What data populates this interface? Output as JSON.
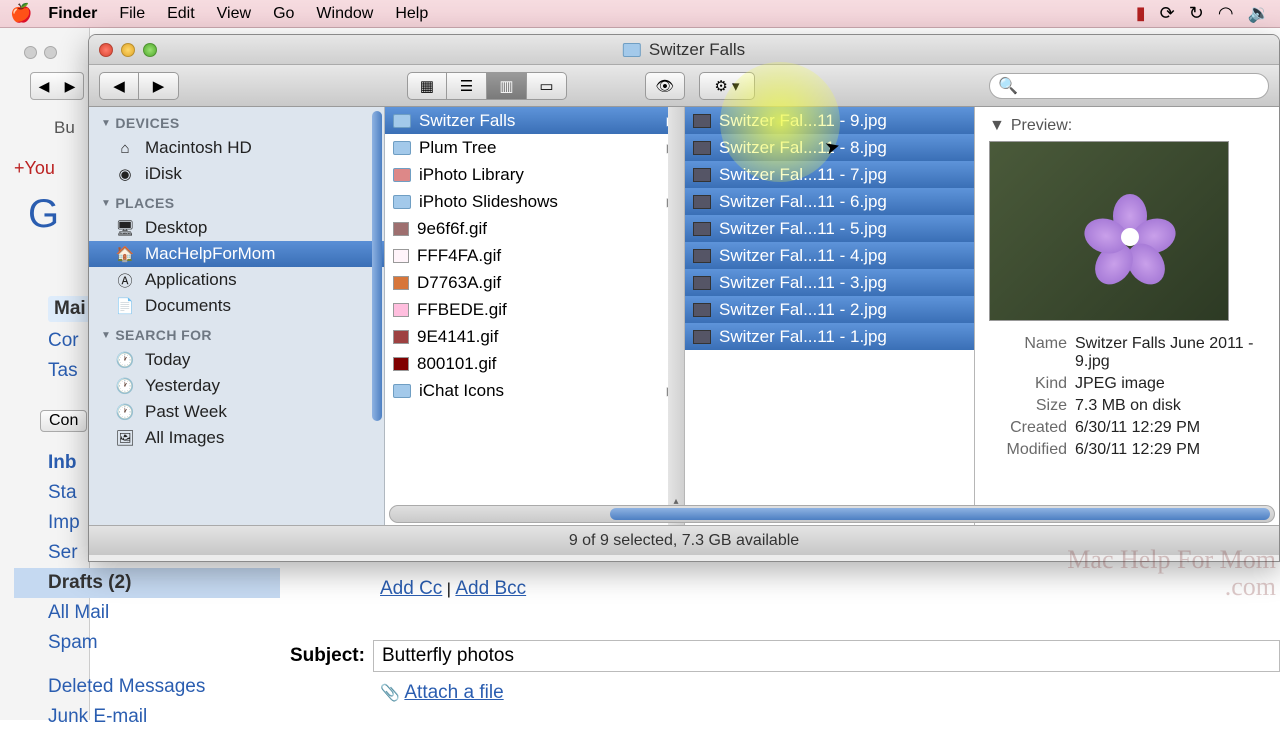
{
  "menubar": {
    "app": "Finder",
    "items": [
      "File",
      "Edit",
      "View",
      "Go",
      "Window",
      "Help"
    ]
  },
  "finder": {
    "title": "Switzer Falls",
    "sidebar": {
      "sections": [
        {
          "label": "DEVICES",
          "items": [
            {
              "name": "Macintosh HD",
              "icon": "hdd"
            },
            {
              "name": "iDisk",
              "icon": "idisk"
            }
          ]
        },
        {
          "label": "PLACES",
          "items": [
            {
              "name": "Desktop",
              "icon": "desktop"
            },
            {
              "name": "MacHelpForMom",
              "icon": "home",
              "selected": true
            },
            {
              "name": "Applications",
              "icon": "apps"
            },
            {
              "name": "Documents",
              "icon": "doc"
            }
          ]
        },
        {
          "label": "SEARCH FOR",
          "items": [
            {
              "name": "Today",
              "icon": "clock"
            },
            {
              "name": "Yesterday",
              "icon": "clock"
            },
            {
              "name": "Past Week",
              "icon": "clock"
            },
            {
              "name": "All Images",
              "icon": "img"
            }
          ]
        }
      ]
    },
    "column1": [
      {
        "name": "Switzer Falls",
        "type": "folder",
        "selected": true,
        "arrow": true
      },
      {
        "name": "Plum Tree",
        "type": "folder",
        "arrow": true
      },
      {
        "name": "iPhoto Library",
        "type": "app"
      },
      {
        "name": "iPhoto Slideshows",
        "type": "folder",
        "arrow": true
      },
      {
        "name": "9e6f6f.gif",
        "type": "gif",
        "color": "#9e6f6f"
      },
      {
        "name": "FFF4FA.gif",
        "type": "gif",
        "color": "#fff4fa"
      },
      {
        "name": "D7763A.gif",
        "type": "gif",
        "color": "#d7763a"
      },
      {
        "name": "FFBEDE.gif",
        "type": "gif",
        "color": "#ffbede"
      },
      {
        "name": "9E4141.gif",
        "type": "gif",
        "color": "#9e4141"
      },
      {
        "name": "800101.gif",
        "type": "gif",
        "color": "#800101"
      },
      {
        "name": "iChat Icons",
        "type": "folder",
        "arrow": true
      }
    ],
    "column2": [
      {
        "name": "Switzer Fal...11 - 9.jpg"
      },
      {
        "name": "Switzer Fal...11 - 8.jpg"
      },
      {
        "name": "Switzer Fal...11 - 7.jpg"
      },
      {
        "name": "Switzer Fal...11 - 6.jpg"
      },
      {
        "name": "Switzer Fal...11 - 5.jpg"
      },
      {
        "name": "Switzer Fal...11 - 4.jpg"
      },
      {
        "name": "Switzer Fal...11 - 3.jpg"
      },
      {
        "name": "Switzer Fal...11 - 2.jpg"
      },
      {
        "name": "Switzer Fal...11 - 1.jpg"
      }
    ],
    "preview": {
      "header": "Preview:",
      "meta": {
        "name_label": "Name",
        "name": "Switzer Falls June 2011 - 9.jpg",
        "kind_label": "Kind",
        "kind": "JPEG image",
        "size_label": "Size",
        "size": "7.3 MB on disk",
        "created_label": "Created",
        "created": "6/30/11 12:29 PM",
        "modified_label": "Modified",
        "modified": "6/30/11 12:29 PM"
      }
    },
    "status": "9 of 9 selected, 7.3 GB available"
  },
  "bg": {
    "plusyou": "+You",
    "tab": "Bu",
    "labels": [
      "Mai",
      "Cor",
      "Tas"
    ],
    "compose_btn": "Con"
  },
  "gmail": {
    "folders": [
      {
        "label": "Inb",
        "bold": true
      },
      {
        "label": "Sta"
      },
      {
        "label": "Imp"
      },
      {
        "label": "Ser"
      },
      {
        "label": "Drafts  (2)",
        "selected": true
      },
      {
        "label": "All Mail"
      },
      {
        "label": "Spam"
      },
      {
        "label": "",
        "sep": true
      },
      {
        "label": "Deleted Messages"
      },
      {
        "label": "Junk E-mail"
      }
    ]
  },
  "compose": {
    "add_cc": "Add Cc",
    "add_bcc": "Add Bcc",
    "subject_label": "Subject:",
    "subject_value": "Butterfly photos",
    "attach": "Attach a file"
  },
  "watermark": "Mac\nHelp\nFor\nMom\n.com"
}
